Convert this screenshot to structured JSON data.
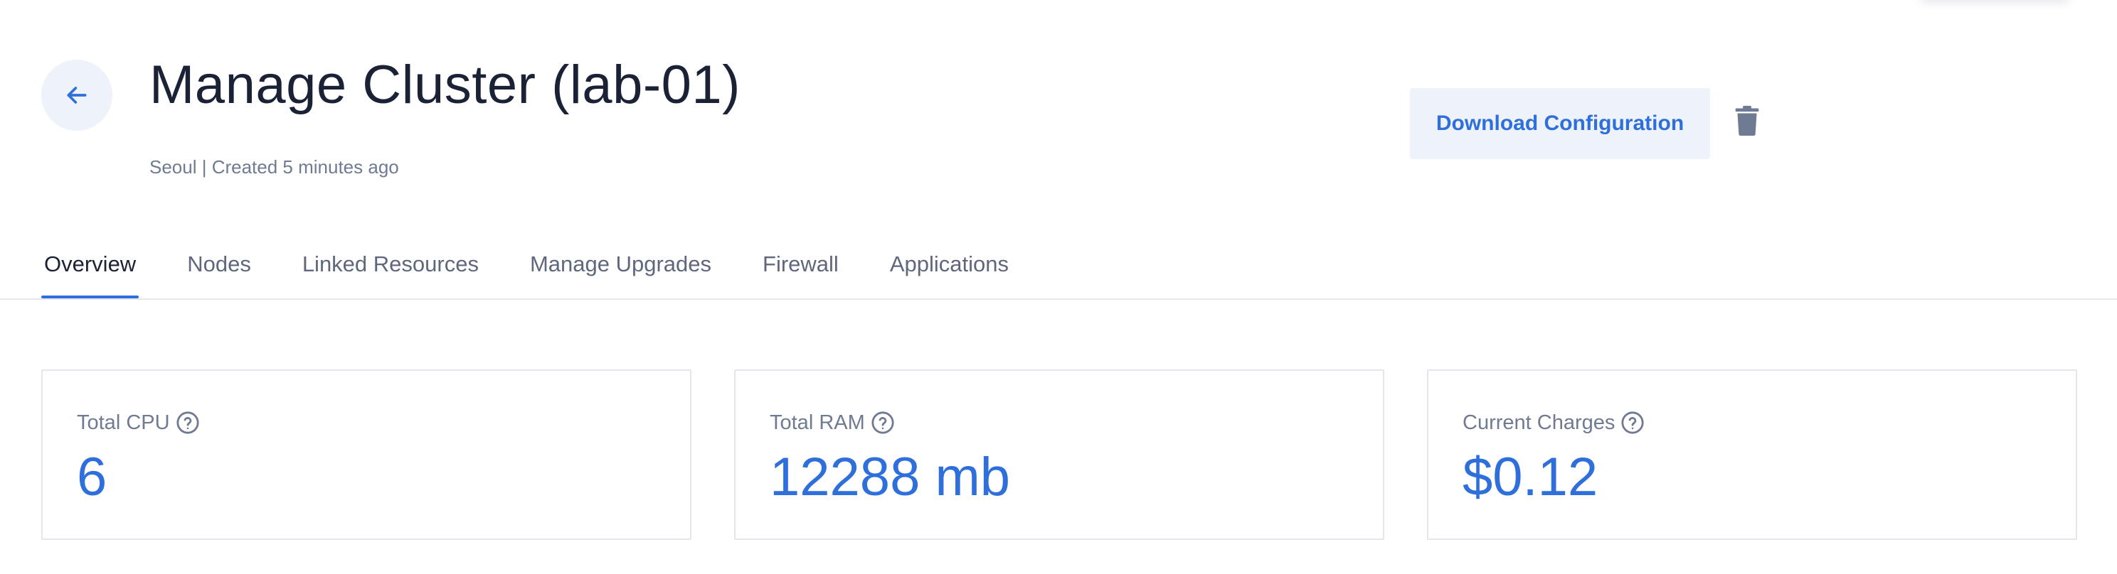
{
  "header": {
    "title": "Manage Cluster (lab-01)",
    "subtitle": "Seoul | Created 5 minutes ago",
    "back_icon": "arrow-left-icon",
    "download_label": "Download Configuration",
    "delete_icon": "trash-icon"
  },
  "tabs": [
    {
      "label": "Overview",
      "active": true
    },
    {
      "label": "Nodes",
      "active": false
    },
    {
      "label": "Linked Resources",
      "active": false
    },
    {
      "label": "Manage Upgrades",
      "active": false
    },
    {
      "label": "Firewall",
      "active": false
    },
    {
      "label": "Applications",
      "active": false
    }
  ],
  "stats": [
    {
      "label": "Total CPU",
      "value": "6"
    },
    {
      "label": "Total RAM",
      "value": "12288 mb"
    },
    {
      "label": "Current Charges",
      "value": "$0.12"
    }
  ],
  "colors": {
    "accent": "#2e6fdc",
    "button_bg": "#edf2fb",
    "muted_text": "#6f7a93",
    "title_text": "#1b2236"
  }
}
